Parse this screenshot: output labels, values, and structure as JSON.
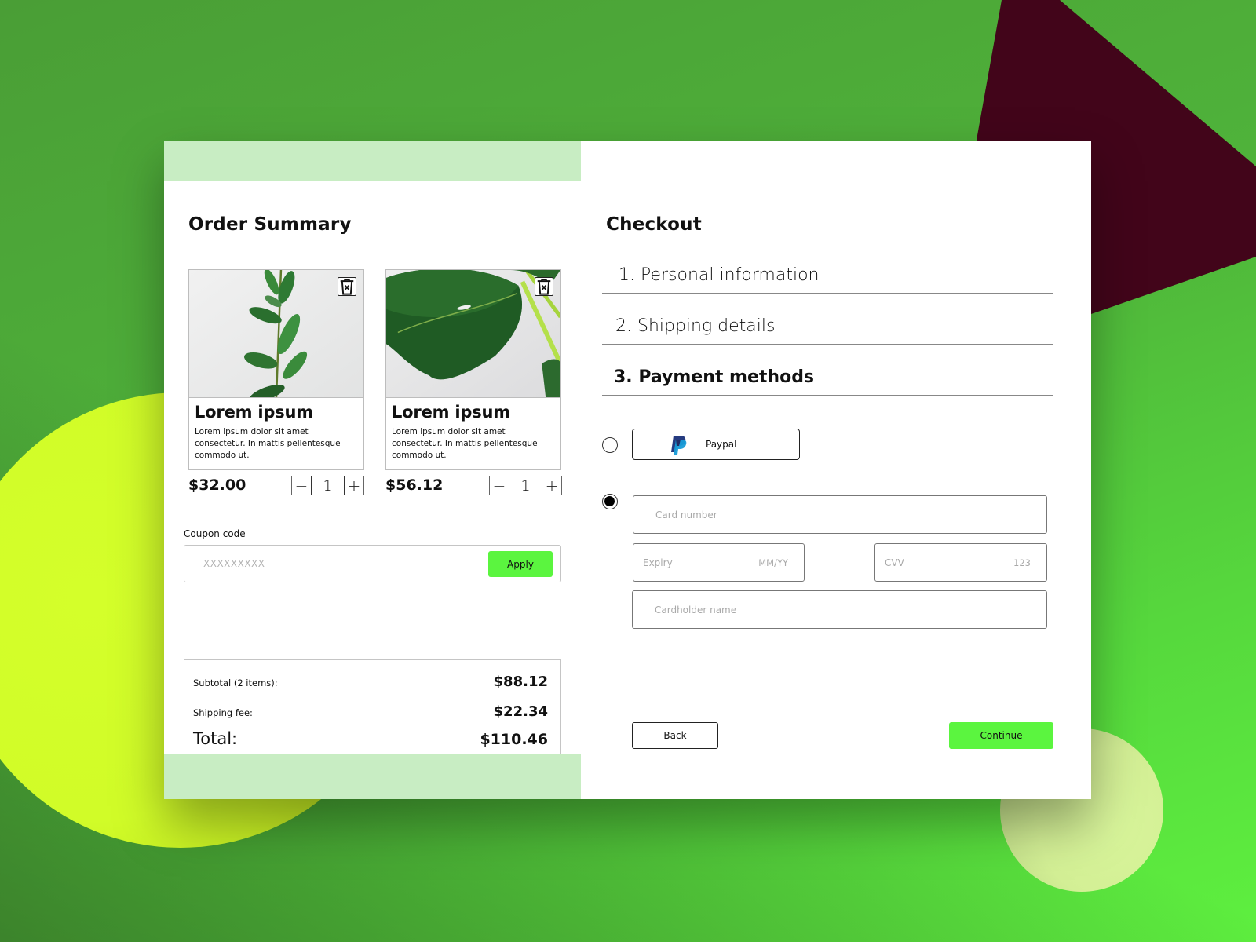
{
  "colors": {
    "accent": "#5bf53f",
    "panel_tint": "#c8edc3",
    "bg_green": "#4fb33a",
    "bg_dark": "#42051a",
    "bg_yellow": "#d4ff2a",
    "bg_light": "#d8f59a"
  },
  "order_summary": {
    "title": "Order Summary",
    "products": [
      {
        "name": "Lorem ipsum",
        "description": "Lorem ipsum dolor sit amet consectetur. In mattis pellentesque commodo ut.",
        "price": "$32.00",
        "quantity": "1",
        "image": "plant-stem-photo",
        "delete_icon": "trash-icon"
      },
      {
        "name": "Lorem ipsum",
        "description": "Lorem ipsum dolor sit amet consectetur. In mattis pellentesque commodo ut.",
        "price": "$56.12",
        "quantity": "1",
        "image": "monstera-leaf-photo",
        "delete_icon": "trash-icon"
      }
    ],
    "stepper": {
      "minus": "−",
      "plus": "+"
    },
    "coupon": {
      "label": "Coupon code",
      "placeholder": "XXXXXXXXX",
      "value": "",
      "apply_label": "Apply"
    },
    "totals": {
      "subtotal_label": "Subtotal (2 items):",
      "subtotal_value": "$88.12",
      "shipping_label": "Shipping fee:",
      "shipping_value": "$22.34",
      "total_label": "Total:",
      "total_value": "$110.46"
    }
  },
  "checkout": {
    "title": "Checkout",
    "steps": [
      {
        "label": "1. Personal information",
        "active": false
      },
      {
        "label": "2. Shipping details",
        "active": false
      },
      {
        "label": "3. Payment methods",
        "active": true
      }
    ],
    "payment": {
      "selected": "card",
      "paypal_label": "Paypal",
      "paypal_icon": "paypal-icon",
      "card_number_placeholder": "Card number",
      "expiry_placeholder": "Expiry",
      "expiry_hint": "MM/YY",
      "cvv_placeholder": "CVV",
      "cvv_hint": "123",
      "cardholder_placeholder": "Cardholder name"
    },
    "back_label": "Back",
    "continue_label": "Continue"
  }
}
